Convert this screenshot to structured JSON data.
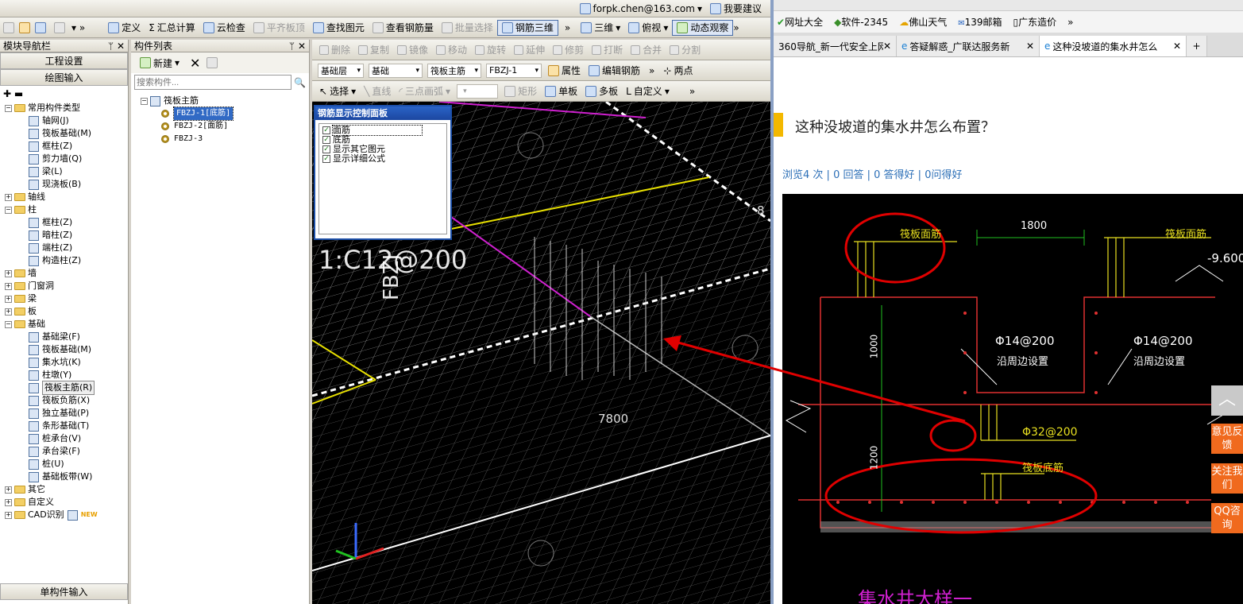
{
  "app": {
    "row1": {
      "user": "forpk.chen@163.com",
      "suggest": "我要建议"
    },
    "row2": [
      "定义",
      "汇总计算",
      "云检查",
      "平齐板顶",
      "查找图元",
      "查看钢筋量",
      "批量选择",
      "钢筋三维",
      "三维",
      "俯视",
      "动态观察"
    ],
    "row3": [
      "删除",
      "复制",
      "镜像",
      "移动",
      "旋转",
      "延伸",
      "修剪",
      "打断",
      "合并",
      "分割"
    ],
    "row4": {
      "combos": [
        "基础层",
        "基础",
        "筏板主筋",
        "FBZJ-1"
      ],
      "buttons": [
        "属性",
        "编辑钢筋",
        "两点"
      ]
    },
    "row5": {
      "buttons": [
        "选择",
        "直线",
        "三点画弧",
        "矩形",
        "单板",
        "多板",
        "自定义"
      ]
    },
    "nav": {
      "title": "模块导航栏",
      "pin": "ꟷ",
      "close": "✕",
      "btn1": "工程设置",
      "btn2": "绘图输入",
      "bottom": "单构件输入",
      "tree": [
        {
          "l": 0,
          "t": "常用构件类型",
          "f": 1,
          "e": "−"
        },
        {
          "l": 1,
          "t": "轴网(J)"
        },
        {
          "l": 1,
          "t": "筏板基础(M)"
        },
        {
          "l": 1,
          "t": "框柱(Z)"
        },
        {
          "l": 1,
          "t": "剪力墙(Q)"
        },
        {
          "l": 1,
          "t": "梁(L)"
        },
        {
          "l": 1,
          "t": "现浇板(B)"
        },
        {
          "l": 0,
          "t": "轴线",
          "f": 1,
          "e": "+"
        },
        {
          "l": 0,
          "t": "柱",
          "f": 1,
          "e": "−"
        },
        {
          "l": 1,
          "t": "框柱(Z)"
        },
        {
          "l": 1,
          "t": "暗柱(Z)"
        },
        {
          "l": 1,
          "t": "端柱(Z)"
        },
        {
          "l": 1,
          "t": "构造柱(Z)"
        },
        {
          "l": 0,
          "t": "墙",
          "f": 1,
          "e": "+"
        },
        {
          "l": 0,
          "t": "门窗洞",
          "f": 1,
          "e": "+"
        },
        {
          "l": 0,
          "t": "梁",
          "f": 1,
          "e": "+"
        },
        {
          "l": 0,
          "t": "板",
          "f": 1,
          "e": "+"
        },
        {
          "l": 0,
          "t": "基础",
          "f": 1,
          "e": "−"
        },
        {
          "l": 1,
          "t": "基础梁(F)"
        },
        {
          "l": 1,
          "t": "筏板基础(M)"
        },
        {
          "l": 1,
          "t": "集水坑(K)"
        },
        {
          "l": 1,
          "t": "柱墩(Y)"
        },
        {
          "l": 1,
          "t": "筏板主筋(R)",
          "sel": 1
        },
        {
          "l": 1,
          "t": "筏板负筋(X)"
        },
        {
          "l": 1,
          "t": "独立基础(P)"
        },
        {
          "l": 1,
          "t": "条形基础(T)"
        },
        {
          "l": 1,
          "t": "桩承台(V)"
        },
        {
          "l": 1,
          "t": "承台梁(F)"
        },
        {
          "l": 1,
          "t": "桩(U)"
        },
        {
          "l": 1,
          "t": "基础板带(W)"
        },
        {
          "l": 0,
          "t": "其它",
          "f": 1,
          "e": "+"
        },
        {
          "l": 0,
          "t": "自定义",
          "f": 1,
          "e": "+"
        },
        {
          "l": 0,
          "t": "CAD识别",
          "f": 1,
          "e": "+",
          "badge": "NEW"
        }
      ]
    },
    "comp": {
      "title": "构件列表",
      "new": "新建",
      "search_ph": "搜索构件...",
      "root": "筏板主筋",
      "items": [
        "FBZJ-1[底筋]",
        "FBZJ-2[面筋]",
        "FBZJ-3"
      ]
    },
    "ctrl": {
      "title": "钢筋显示控制面板",
      "items": [
        "面筋",
        "底筋",
        "显示其它图元",
        "显示详细公式"
      ]
    },
    "viewport": {
      "text1": "1:C12@200",
      "text2": "FBZJ",
      "dim": "7800",
      "edge": "8"
    }
  },
  "browser": {
    "bookmarks": [
      "网址大全",
      "软件-2345",
      "佛山天气",
      "139邮箱",
      "广东造价"
    ],
    "tabs": [
      "360导航_新一代安全上网",
      "答疑解惑_广联达服务新",
      "这种没坡道的集水井怎么"
    ],
    "question": "这种没坡道的集水井怎么布置？",
    "stats": [
      "浏览4 次",
      "0 回答",
      "0 答得好",
      "0问得好"
    ],
    "drawing": {
      "top_left": "筏板面筋",
      "top_right": "筏板面筋",
      "dim_w": "1800",
      "elev": "-9.600",
      "rebar1": "Φ14@200",
      "note1": "沿周边设置",
      "rebar2": "Φ14@200",
      "note2": "沿周边设置",
      "d1000": "1000",
      "d1200": "1200",
      "bottom_bar": "Φ32@200",
      "bottom": "筏板底筋",
      "caption": "集水井大样一"
    },
    "side": [
      "意见反馈",
      "关注我们",
      "QQ咨询"
    ]
  }
}
